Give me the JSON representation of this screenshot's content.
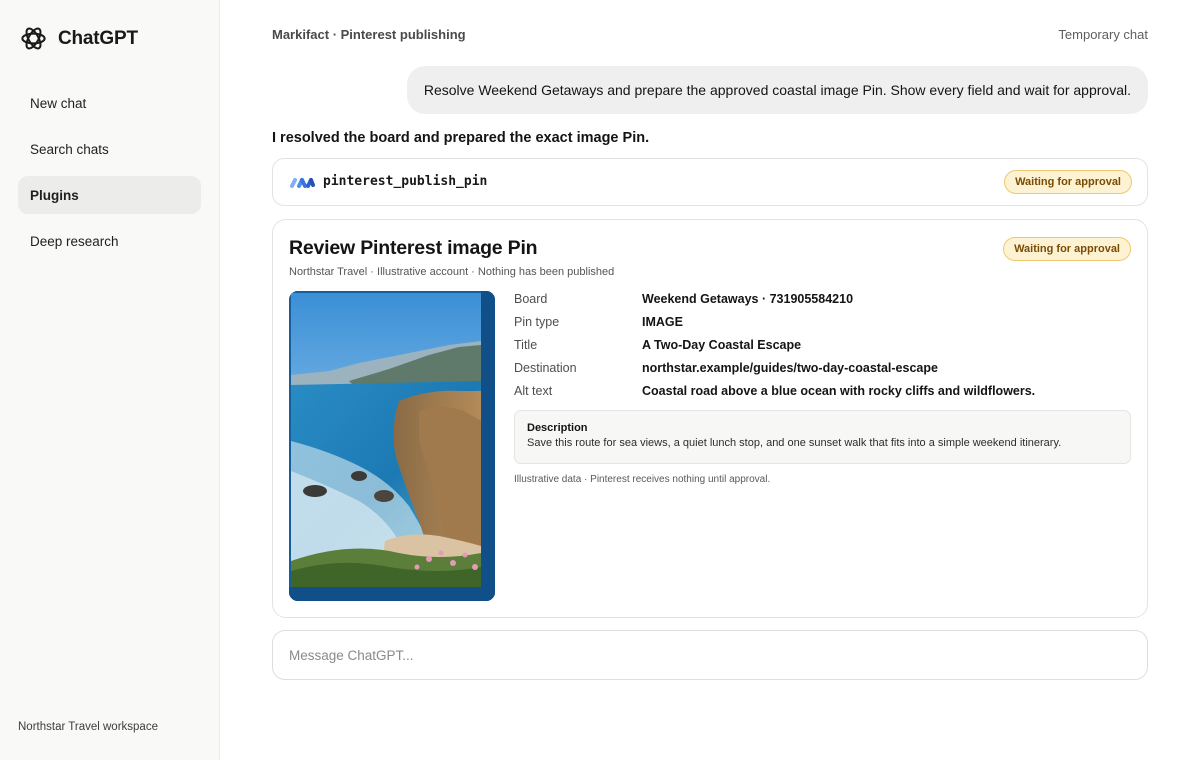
{
  "sidebar": {
    "brand": "ChatGPT",
    "items": [
      {
        "label": "New chat"
      },
      {
        "label": "Search chats"
      },
      {
        "label": "Plugins",
        "active": true
      },
      {
        "label": "Deep research"
      }
    ],
    "workspace": "Northstar Travel workspace"
  },
  "header": {
    "breadcrumb": "Markifact · Pinterest publishing",
    "temporary_chat": "Temporary chat"
  },
  "conversation": {
    "user_message": "Resolve Weekend Getaways and prepare the approved coastal image Pin. Show every field and wait for approval.",
    "assistant_message": "I resolved the board and prepared the exact image Pin."
  },
  "tool_call": {
    "name": "pinterest_publish_pin",
    "status": "Waiting for approval"
  },
  "review": {
    "title": "Review Pinterest image Pin",
    "subtitle": "Northstar Travel · Illustrative account · Nothing has been published",
    "status": "Waiting for approval",
    "fields": [
      {
        "label": "Board",
        "value": "Weekend Getaways · 731905584210"
      },
      {
        "label": "Pin type",
        "value": "IMAGE"
      },
      {
        "label": "Title",
        "value": "A Two-Day Coastal Escape"
      },
      {
        "label": "Destination",
        "value": "northstar.example/guides/two-day-coastal-escape"
      },
      {
        "label": "Alt text",
        "value": "Coastal road above a blue ocean with rocky cliffs and wildflowers."
      }
    ],
    "description_label": "Description",
    "description": "Save this route for sea views, a quiet lunch stop, and one sunset walk that fits into a simple weekend itinerary.",
    "note": "Illustrative data · Pinterest receives nothing until approval."
  },
  "composer": {
    "placeholder": "Message ChatGPT..."
  },
  "colors": {
    "badge_bg": "#fdf2d2",
    "badge_border": "#ecc96f",
    "badge_text": "#7a4c06",
    "sidebar_bg": "#f9f9f8",
    "active_item_bg": "#ececeb",
    "markifact_blue": "#3f7ee8"
  },
  "icons": {
    "brand": "openai-logo-icon",
    "tool": "markifact-logo-icon",
    "pin_image": "coastal-landscape-image"
  }
}
